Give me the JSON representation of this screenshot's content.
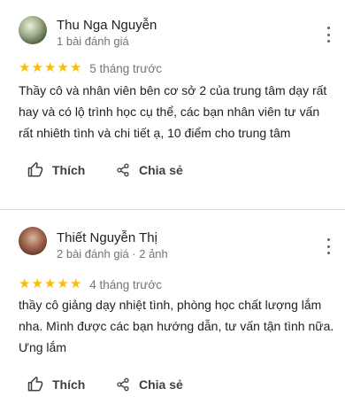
{
  "reviews": [
    {
      "name": "Thu Nga Nguyễn",
      "meta": "1 bài đánh giá",
      "stars": 5,
      "when": "5 tháng trước",
      "text": "Thầy cô và nhân viên bên cơ sở 2 của trung tâm dạy rất hay và có lộ trình học cụ thể, các bạn nhân viên tư vấn rất nhiêth tình và chi tiết ạ, 10 điểm cho trung tâm",
      "like_label": "Thích",
      "share_label": "Chia sẻ"
    },
    {
      "name": "Thiết Nguyễn Thị",
      "meta": "2 bài đánh giá · 2 ảnh",
      "stars": 5,
      "when": "4 tháng trước",
      "text": "thầy cô giảng dạy nhiệt tình, phòng học chất lượng lắm nha. Mình được các bạn hướng dẫn, tư vấn tận tình nữa. Ưng lắm",
      "like_label": "Thích",
      "share_label": "Chia sẻ"
    }
  ],
  "colors": {
    "star": "#fbbc04",
    "meta": "#70757a",
    "text": "#202124",
    "divider": "#dadce0"
  },
  "icons": {
    "like": "thumb-up-icon",
    "share": "share-icon",
    "more": "more-vert-icon"
  }
}
